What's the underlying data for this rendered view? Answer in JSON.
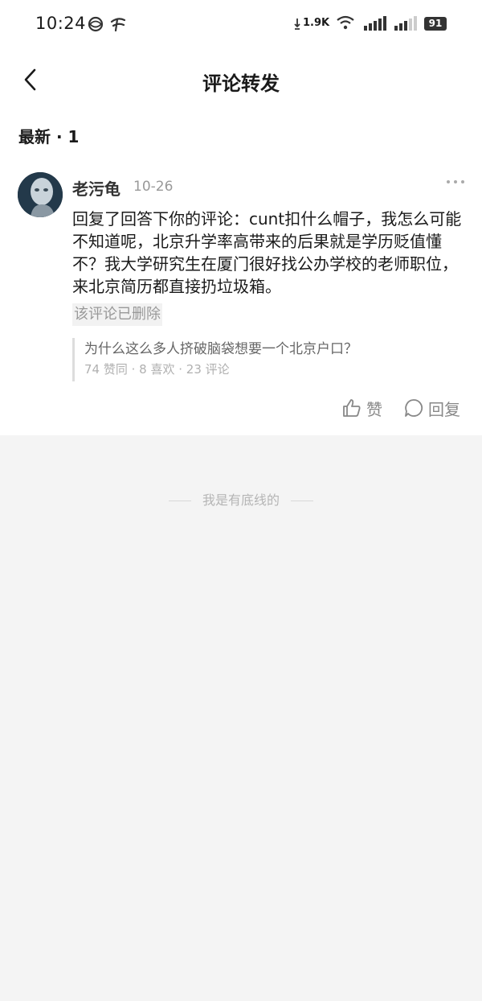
{
  "status_bar": {
    "time": "10:24",
    "net_speed": "1.9K",
    "battery": "91",
    "icons": [
      "china-mobile-icon",
      "china-telecom-icon",
      "download-arrow-icon",
      "wifi-icon",
      "signal-1-icon",
      "signal-2-icon"
    ]
  },
  "header": {
    "title": "评论转发",
    "back_icon": "chevron-left-icon"
  },
  "section": {
    "label": "最新 · 1"
  },
  "comment": {
    "username": "老污龟",
    "date": "10-26",
    "more_icon": "more-dots-icon",
    "text": "回复了回答下你的评论：cunt扣什么帽子，我怎么可能不知道呢，北京升学率高带来的后果就是学历贬值懂不？我大学研究生在厦门很好找公办学校的老师职位，来北京简历都直接扔垃圾箱。",
    "deleted_notice": "该评论已删除",
    "quote": {
      "title": "为什么这么多人挤破脑袋想要一个北京户口？",
      "meta": "74 赞同 · 8 喜欢 · 23 评论"
    },
    "actions": {
      "like_label": "赞",
      "reply_label": "回复"
    }
  },
  "footer": {
    "text": "我是有底线的"
  },
  "colors": {
    "page_bg": "#f4f4f4",
    "card_bg": "#ffffff",
    "muted": "#999999"
  }
}
